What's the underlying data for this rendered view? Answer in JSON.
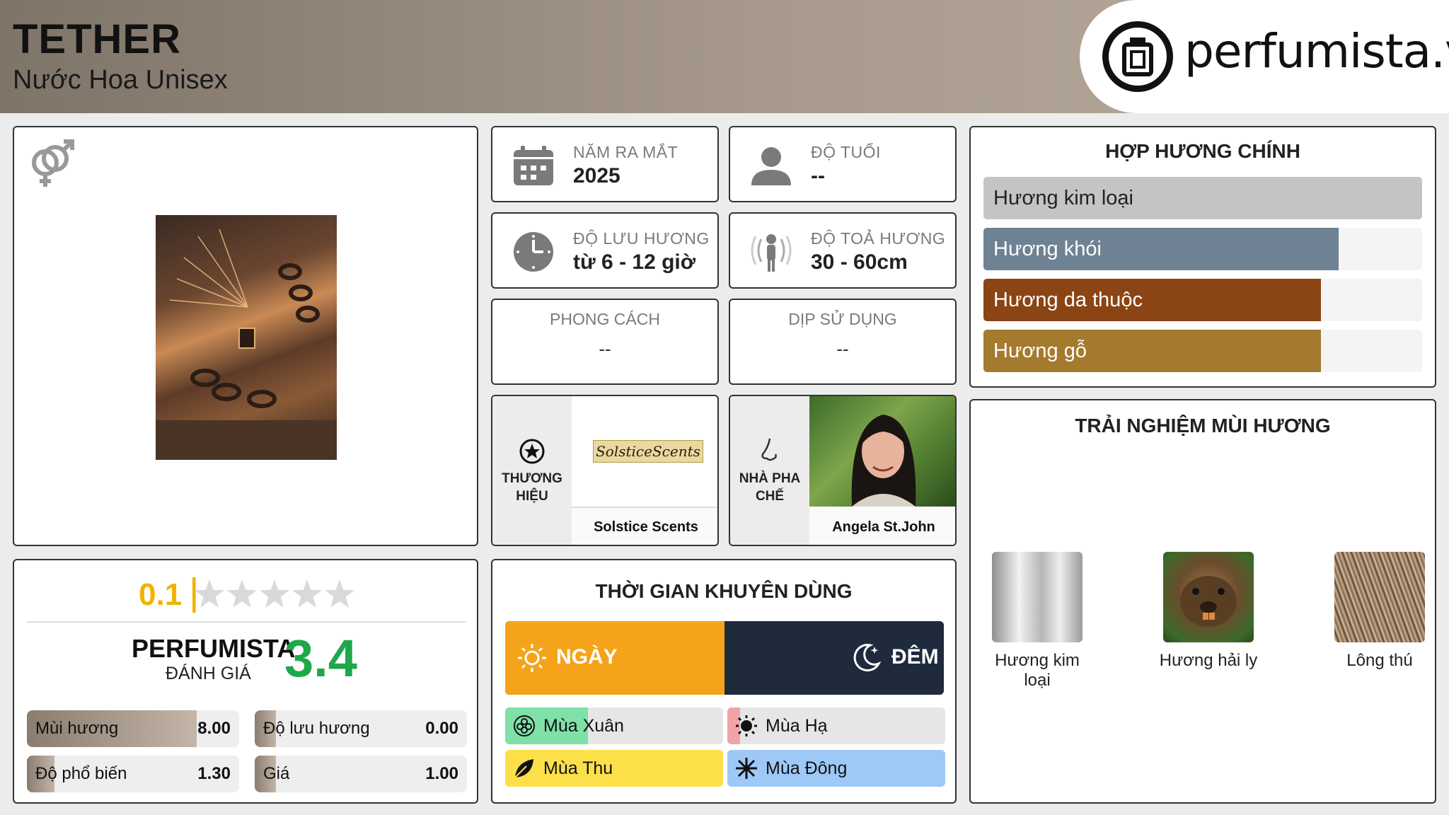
{
  "header": {
    "title": "TETHER",
    "subtitle": "Nước Hoa Unisex",
    "logo_text": "perfumista.vn"
  },
  "info": {
    "launch_label": "NĂM RA MẮT",
    "launch_value": "2025",
    "age_label": "ĐỘ TUỔI",
    "age_value": "--",
    "longevity_label": "ĐỘ LƯU HƯƠNG",
    "longevity_value": "từ 6 - 12 giờ",
    "sillage_label": "ĐỘ TOẢ HƯƠNG",
    "sillage_value": "30 - 60cm",
    "style_label": "PHONG CÁCH",
    "style_value": "--",
    "occasion_label": "DỊP SỬ DỤNG",
    "occasion_value": "--",
    "brand_label_1": "THƯƠNG",
    "brand_label_2": "HIỆU",
    "brand_name": "Solstice Scents",
    "brand_logo_text": "SolsticeScents",
    "perfumer_label_1": "NHÀ PHA",
    "perfumer_label_2": "CHẾ",
    "perfumer_name": "Angela St.John"
  },
  "accords": {
    "title": "HỢP HƯƠNG CHÍNH",
    "items": [
      {
        "label": "Hương kim loại",
        "value": 1.0,
        "color": "#c4c4c4"
      },
      {
        "label": "Hương khói",
        "value": 0.81,
        "color": "#6f8294"
      },
      {
        "label": "Hương da thuộc",
        "value": 0.77,
        "color": "#8b4413"
      },
      {
        "label": "Hương gỗ",
        "value": 0.77,
        "color": "#a47a2e"
      }
    ]
  },
  "rating": {
    "user_score": "0.1",
    "user_stars_fraction": 0.02,
    "brand_line_1": "PERFUMISTA",
    "brand_line_2": "ĐÁNH GIÁ",
    "score": "3.4",
    "stats": [
      {
        "label": "Mùi hương",
        "value": "8.00",
        "fraction": 0.8
      },
      {
        "label": "Độ lưu hương",
        "value": "0.00",
        "fraction": 0.0
      },
      {
        "label": "Độ phổ biến",
        "value": "1.30",
        "fraction": 0.13
      },
      {
        "label": "Giá",
        "value": "1.00",
        "fraction": 0.1
      }
    ]
  },
  "timing": {
    "title": "THỜI GIAN KHUYÊN DÙNG",
    "day_label": "NGÀY",
    "night_label": "ĐÊM",
    "day_fraction": 0.5,
    "day_color": "#f5a31a",
    "night_color": "#1f2a3c",
    "seasons": [
      {
        "label": "Mùa Xuân",
        "fraction": 0.38,
        "color": "#7fe0a8",
        "icon": "flower-icon"
      },
      {
        "label": "Mùa Hạ",
        "fraction": 0.06,
        "color": "#f2a3a8",
        "icon": "sun-icon"
      },
      {
        "label": "Mùa Thu",
        "fraction": 1.0,
        "color": "#fbe04a",
        "icon": "leaf-icon"
      },
      {
        "label": "Mùa Đông",
        "fraction": 1.0,
        "color": "#9ec9f7",
        "icon": "snowflake-icon"
      }
    ]
  },
  "experience": {
    "title": "TRẢI NGHIỆM MÙI HƯƠNG",
    "notes": [
      {
        "label_1": "Hương kim",
        "label_2": "loại"
      },
      {
        "label_1": "Hương hải ly",
        "label_2": ""
      },
      {
        "label_1": "Lông thú",
        "label_2": ""
      }
    ]
  }
}
